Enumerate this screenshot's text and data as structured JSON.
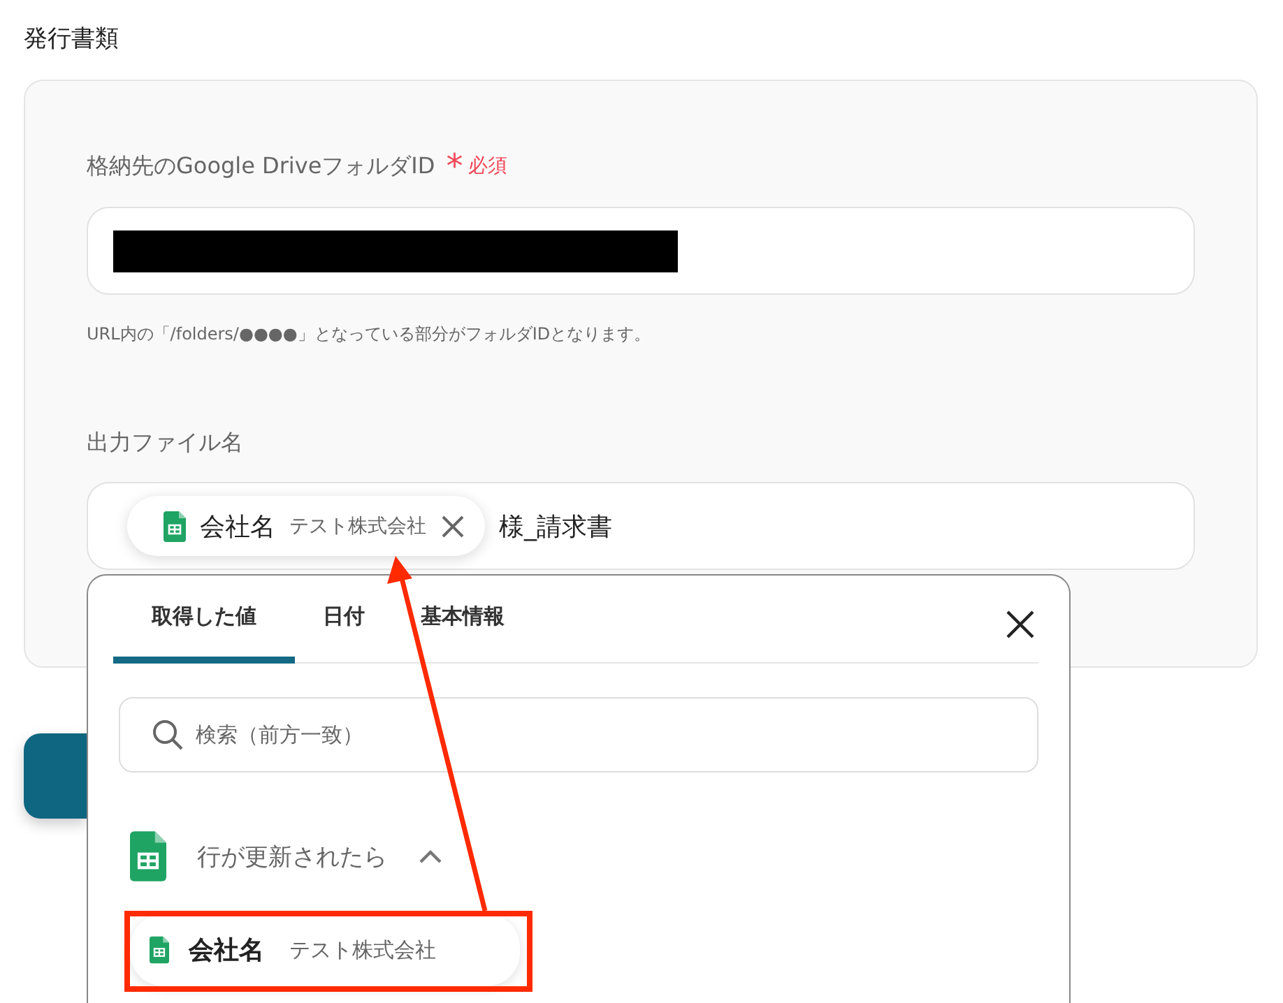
{
  "section_title": "発行書類",
  "folder_field": {
    "label": "格納先のGoogle DriveフォルダID",
    "required_mark": "*",
    "required": "必須",
    "redacted": true,
    "help": "URL内の「/folders/●●●●」となっている部分がフォルダIDとなります。"
  },
  "filename_field": {
    "label": "出力ファイル名",
    "chip": {
      "name": "会社名",
      "value": "テスト株式会社"
    },
    "suffix": "様_請求書"
  },
  "picker": {
    "tabs": [
      {
        "label": "取得した値",
        "selected": true
      },
      {
        "label": "日付",
        "selected": false
      },
      {
        "label": "基本情報",
        "selected": false
      }
    ],
    "search": {
      "placeholder": "検索（前方一致）"
    },
    "group": {
      "title": "行が更新されたら",
      "expanded": true
    },
    "items": [
      {
        "name": "会社名",
        "value": "テスト株式会社",
        "highlighted": true
      }
    ]
  }
}
